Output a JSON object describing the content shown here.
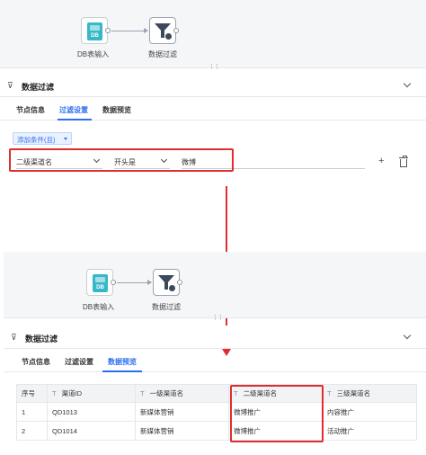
{
  "top": {
    "nodes": {
      "db_label": "DB表输入",
      "db_icon_text": "DB",
      "filter_label": "数据过滤"
    },
    "header_title": "数据过滤",
    "tabs": [
      "节点信息",
      "过滤设置",
      "数据预览"
    ],
    "active_tab": 1,
    "add_condition": "添加条件(且)",
    "condition": {
      "field": "二级渠道名",
      "operator": "开头是",
      "value": "微博"
    }
  },
  "bottom": {
    "nodes": {
      "db_label": "DB表输入",
      "db_icon_text": "DB",
      "filter_label": "数据过滤"
    },
    "header_title": "数据过滤",
    "tabs": [
      "节点信息",
      "过滤设置",
      "数据预览"
    ],
    "active_tab": 2,
    "table": {
      "type_mark": "T",
      "columns": [
        "序号",
        "渠道ID",
        "一级渠道名",
        "二级渠道名",
        "三级渠道名"
      ],
      "rows": [
        [
          "1",
          "QD1013",
          "新媒体营销",
          "微博推广",
          "内容推广"
        ],
        [
          "2",
          "QD1014",
          "新媒体营销",
          "微博推广",
          "活动推广"
        ]
      ]
    }
  },
  "colors": {
    "accent": "#2d6ff0",
    "highlight": "#e02d2d",
    "db_icon": "#35b8c8"
  }
}
